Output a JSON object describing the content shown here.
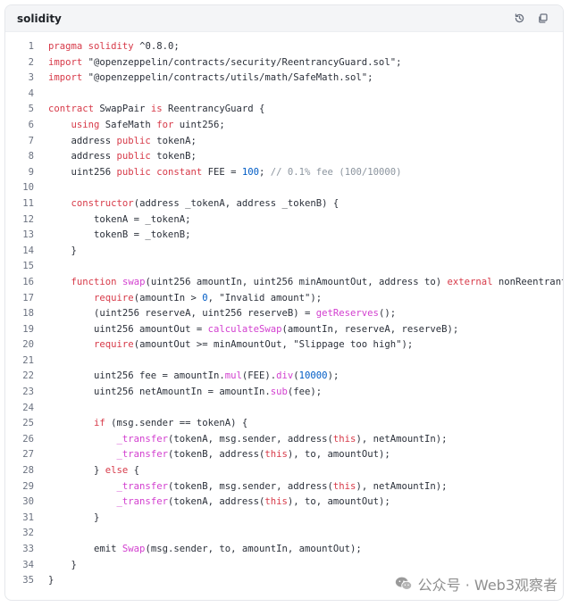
{
  "header": {
    "language": "solidity",
    "icons": [
      "history-icon",
      "copy-icon"
    ]
  },
  "code": {
    "lines": [
      [
        [
          "kw",
          "pragma"
        ],
        [
          "kw",
          " solidity"
        ],
        [
          "id",
          " ^0.8.0;"
        ]
      ],
      [
        [
          "kw",
          "import"
        ],
        [
          "str",
          " \"@openzeppelin/contracts/security/ReentrancyGuard.sol\";"
        ]
      ],
      [
        [
          "kw",
          "import"
        ],
        [
          "str",
          " \"@openzeppelin/contracts/utils/math/SafeMath.sol\";"
        ]
      ],
      [],
      [
        [
          "kw",
          "contract"
        ],
        [
          "id",
          " SwapPair "
        ],
        [
          "kw",
          "is"
        ],
        [
          "id",
          " ReentrancyGuard {"
        ]
      ],
      [
        [
          "id",
          "    "
        ],
        [
          "kw",
          "using"
        ],
        [
          "id",
          " SafeMath "
        ],
        [
          "kw",
          "for"
        ],
        [
          "id",
          " uint256;"
        ]
      ],
      [
        [
          "id",
          "    address "
        ],
        [
          "kw",
          "public"
        ],
        [
          "id",
          " tokenA;"
        ]
      ],
      [
        [
          "id",
          "    address "
        ],
        [
          "kw",
          "public"
        ],
        [
          "id",
          " tokenB;"
        ]
      ],
      [
        [
          "id",
          "    uint256 "
        ],
        [
          "kw",
          "public constant"
        ],
        [
          "id",
          " FEE = "
        ],
        [
          "num",
          "100"
        ],
        [
          "id",
          "; "
        ],
        [
          "com",
          "// 0.1% fee (100/10000)"
        ]
      ],
      [],
      [
        [
          "id",
          "    "
        ],
        [
          "kw",
          "constructor"
        ],
        [
          "id",
          "(address _tokenA, address _tokenB) {"
        ]
      ],
      [
        [
          "id",
          "        tokenA = _tokenA;"
        ]
      ],
      [
        [
          "id",
          "        tokenB = _tokenB;"
        ]
      ],
      [
        [
          "id",
          "    }"
        ]
      ],
      [],
      [
        [
          "id",
          "    "
        ],
        [
          "kw",
          "function"
        ],
        [
          "id",
          " "
        ],
        [
          "fn",
          "swap"
        ],
        [
          "id",
          "(uint256 amountIn, uint256 minAmountOut, address to) "
        ],
        [
          "kw",
          "external"
        ],
        [
          "id",
          " nonReentrant {"
        ]
      ],
      [
        [
          "id",
          "        "
        ],
        [
          "kw",
          "require"
        ],
        [
          "id",
          "(amountIn > "
        ],
        [
          "num",
          "0"
        ],
        [
          "id",
          ", \"Invalid amount\");"
        ]
      ],
      [
        [
          "id",
          "        (uint256 reserveA, uint256 reserveB) = "
        ],
        [
          "fn",
          "getReserves"
        ],
        [
          "id",
          "();"
        ]
      ],
      [
        [
          "id",
          "        uint256 amountOut = "
        ],
        [
          "fn",
          "calculateSwap"
        ],
        [
          "id",
          "(amountIn, reserveA, reserveB);"
        ]
      ],
      [
        [
          "id",
          "        "
        ],
        [
          "kw",
          "require"
        ],
        [
          "id",
          "(amountOut >= minAmountOut, \"Slippage too high\");"
        ]
      ],
      [],
      [
        [
          "id",
          "        uint256 fee = amountIn."
        ],
        [
          "fn",
          "mul"
        ],
        [
          "id",
          "(FEE)."
        ],
        [
          "fn",
          "div"
        ],
        [
          "id",
          "("
        ],
        [
          "num",
          "10000"
        ],
        [
          "id",
          ");"
        ]
      ],
      [
        [
          "id",
          "        uint256 netAmountIn = amountIn."
        ],
        [
          "fn",
          "sub"
        ],
        [
          "id",
          "(fee);"
        ]
      ],
      [],
      [
        [
          "id",
          "        "
        ],
        [
          "kw",
          "if"
        ],
        [
          "id",
          " (msg.sender == tokenA) {"
        ]
      ],
      [
        [
          "id",
          "            "
        ],
        [
          "fn",
          "_transfer"
        ],
        [
          "id",
          "(tokenA, msg.sender, address("
        ],
        [
          "kw",
          "this"
        ],
        [
          "id",
          "), netAmountIn);"
        ]
      ],
      [
        [
          "id",
          "            "
        ],
        [
          "fn",
          "_transfer"
        ],
        [
          "id",
          "(tokenB, address("
        ],
        [
          "kw",
          "this"
        ],
        [
          "id",
          "), to, amountOut);"
        ]
      ],
      [
        [
          "id",
          "        } "
        ],
        [
          "kw",
          "else"
        ],
        [
          "id",
          " {"
        ]
      ],
      [
        [
          "id",
          "            "
        ],
        [
          "fn",
          "_transfer"
        ],
        [
          "id",
          "(tokenB, msg.sender, address("
        ],
        [
          "kw",
          "this"
        ],
        [
          "id",
          "), netAmountIn);"
        ]
      ],
      [
        [
          "id",
          "            "
        ],
        [
          "fn",
          "_transfer"
        ],
        [
          "id",
          "(tokenA, address("
        ],
        [
          "kw",
          "this"
        ],
        [
          "id",
          "), to, amountOut);"
        ]
      ],
      [
        [
          "id",
          "        }"
        ]
      ],
      [],
      [
        [
          "id",
          "        emit "
        ],
        [
          "fn",
          "Swap"
        ],
        [
          "id",
          "(msg.sender, to, amountIn, amountOut);"
        ]
      ],
      [
        [
          "id",
          "    }"
        ]
      ],
      [
        [
          "id",
          "}"
        ]
      ]
    ]
  },
  "watermark": {
    "text": "公众号 · Web3观察者"
  },
  "colors": {
    "keyword": "#d73a49",
    "function": "#d23fcf",
    "number": "#005cc5",
    "comment": "#8b949e",
    "text": "#2b303a"
  }
}
